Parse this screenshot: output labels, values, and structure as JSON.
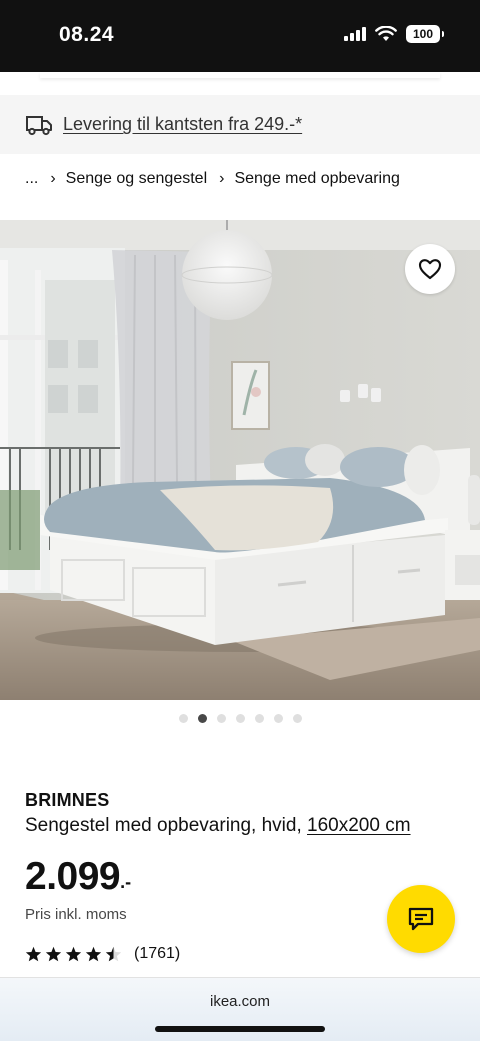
{
  "status_bar": {
    "time": "08.24",
    "battery": "100",
    "icons": [
      "signal-icon",
      "wifi-icon",
      "battery-icon"
    ]
  },
  "delivery": {
    "text": "Levering til kantsten fra 249.-*",
    "icon": "truck-icon"
  },
  "breadcrumb": {
    "ellipsis": "...",
    "items": [
      "Senge og sengestel",
      "Senge med opbevaring"
    ],
    "separator": "›"
  },
  "gallery": {
    "image_count": 7,
    "active_index": 1,
    "favorite_icon": "heart-icon"
  },
  "product": {
    "name": "BRIMNES",
    "description": "Sengestel med opbevaring, hvid,",
    "size": "160x200 cm",
    "price": "2.099",
    "price_suffix": ".-",
    "price_note": "Pris inkl. moms",
    "rating": 4.5,
    "rating_count": "(1761)"
  },
  "chat": {
    "icon": "chat-icon"
  },
  "browser": {
    "url": "ikea.com"
  },
  "colors": {
    "accent_yellow": "#ffdb00",
    "status_bar": "#111111",
    "banner_bg": "#f5f5f5"
  }
}
